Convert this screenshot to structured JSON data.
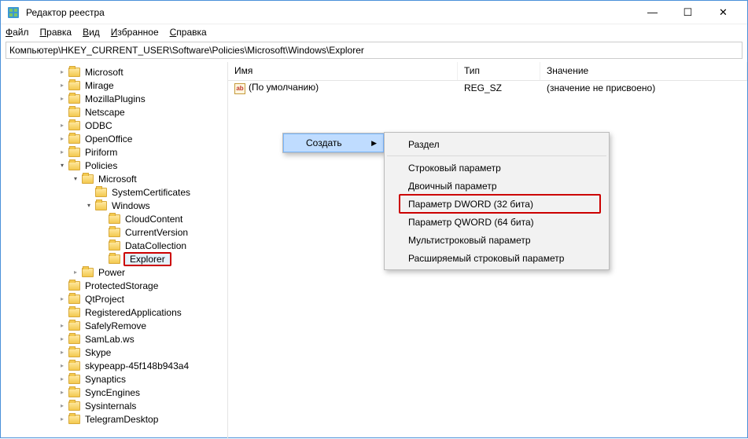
{
  "window": {
    "title": "Редактор реестра"
  },
  "menu": {
    "file": "Файл",
    "edit": "Правка",
    "view": "Вид",
    "favorites": "Избранное",
    "help": "Справка"
  },
  "path": "Компьютер\\HKEY_CURRENT_USER\\Software\\Policies\\Microsoft\\Windows\\Explorer",
  "columns": {
    "name": "Имя",
    "type": "Тип",
    "value": "Значение"
  },
  "values": [
    {
      "name": "(По умолчанию)",
      "type": "REG_SZ",
      "data": "(значение не присвоено)"
    }
  ],
  "tree": [
    {
      "indent": 4,
      "expander": "closed",
      "label": "Microsoft"
    },
    {
      "indent": 4,
      "expander": "closed",
      "label": "Mirage"
    },
    {
      "indent": 4,
      "expander": "closed",
      "label": "MozillaPlugins"
    },
    {
      "indent": 4,
      "expander": "none",
      "label": "Netscape"
    },
    {
      "indent": 4,
      "expander": "closed",
      "label": "ODBC"
    },
    {
      "indent": 4,
      "expander": "closed",
      "label": "OpenOffice"
    },
    {
      "indent": 4,
      "expander": "closed",
      "label": "Piriform"
    },
    {
      "indent": 4,
      "expander": "open",
      "label": "Policies"
    },
    {
      "indent": 5,
      "expander": "open",
      "label": "Microsoft"
    },
    {
      "indent": 6,
      "expander": "none",
      "label": "SystemCertificates"
    },
    {
      "indent": 6,
      "expander": "open",
      "label": "Windows"
    },
    {
      "indent": 7,
      "expander": "none",
      "label": "CloudContent"
    },
    {
      "indent": 7,
      "expander": "none",
      "label": "CurrentVersion"
    },
    {
      "indent": 7,
      "expander": "none",
      "label": "DataCollection"
    },
    {
      "indent": 7,
      "expander": "none",
      "label": "Explorer",
      "selected": true
    },
    {
      "indent": 5,
      "expander": "closed",
      "label": "Power"
    },
    {
      "indent": 4,
      "expander": "none",
      "label": "ProtectedStorage"
    },
    {
      "indent": 4,
      "expander": "closed",
      "label": "QtProject"
    },
    {
      "indent": 4,
      "expander": "none",
      "label": "RegisteredApplications"
    },
    {
      "indent": 4,
      "expander": "closed",
      "label": "SafelyRemove"
    },
    {
      "indent": 4,
      "expander": "closed",
      "label": "SamLab.ws"
    },
    {
      "indent": 4,
      "expander": "closed",
      "label": "Skype"
    },
    {
      "indent": 4,
      "expander": "closed",
      "label": "skypeapp-45f148b943a4"
    },
    {
      "indent": 4,
      "expander": "closed",
      "label": "Synaptics"
    },
    {
      "indent": 4,
      "expander": "closed",
      "label": "SyncEngines"
    },
    {
      "indent": 4,
      "expander": "closed",
      "label": "Sysinternals"
    },
    {
      "indent": 4,
      "expander": "closed",
      "label": "TelegramDesktop"
    }
  ],
  "contextmenu": {
    "create": "Создать",
    "items": [
      {
        "label": "Раздел",
        "sep_after": true
      },
      {
        "label": "Строковый параметр"
      },
      {
        "label": "Двоичный параметр"
      },
      {
        "label": "Параметр DWORD (32 бита)",
        "highlight": true
      },
      {
        "label": "Параметр QWORD (64 бита)"
      },
      {
        "label": "Мультистроковый параметр"
      },
      {
        "label": "Расширяемый строковый параметр"
      }
    ]
  }
}
